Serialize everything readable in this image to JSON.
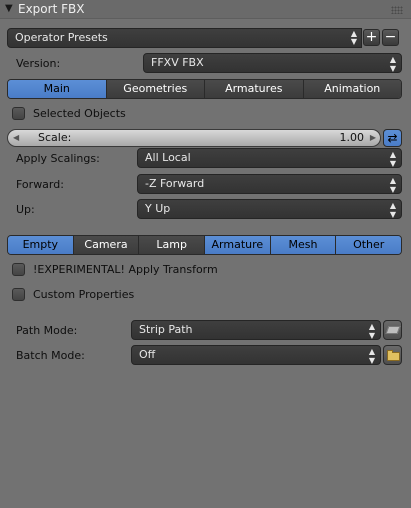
{
  "panel": {
    "title": "Export FBX"
  },
  "presets": {
    "label": "Operator Presets",
    "add": "+",
    "remove": "−"
  },
  "version": {
    "label": "Version:",
    "value": "FFXV FBX"
  },
  "tabs": [
    "Main",
    "Geometries",
    "Armatures",
    "Animation"
  ],
  "selected_objects": "Selected Objects",
  "scale": {
    "label": "Scale:",
    "value": "1.00"
  },
  "apply_scalings": {
    "label": "Apply Scalings:",
    "value": "All Local"
  },
  "forward": {
    "label": "Forward:",
    "value": "-Z Forward"
  },
  "up": {
    "label": "Up:",
    "value": "Y Up"
  },
  "object_types": [
    "Empty",
    "Camera",
    "Lamp",
    "Armature",
    "Mesh",
    "Other"
  ],
  "apply_transform": "!EXPERIMENTAL! Apply Transform",
  "custom_properties": "Custom Properties",
  "path_mode": {
    "label": "Path Mode:",
    "value": "Strip Path"
  },
  "batch_mode": {
    "label": "Batch Mode:",
    "value": "Off"
  }
}
